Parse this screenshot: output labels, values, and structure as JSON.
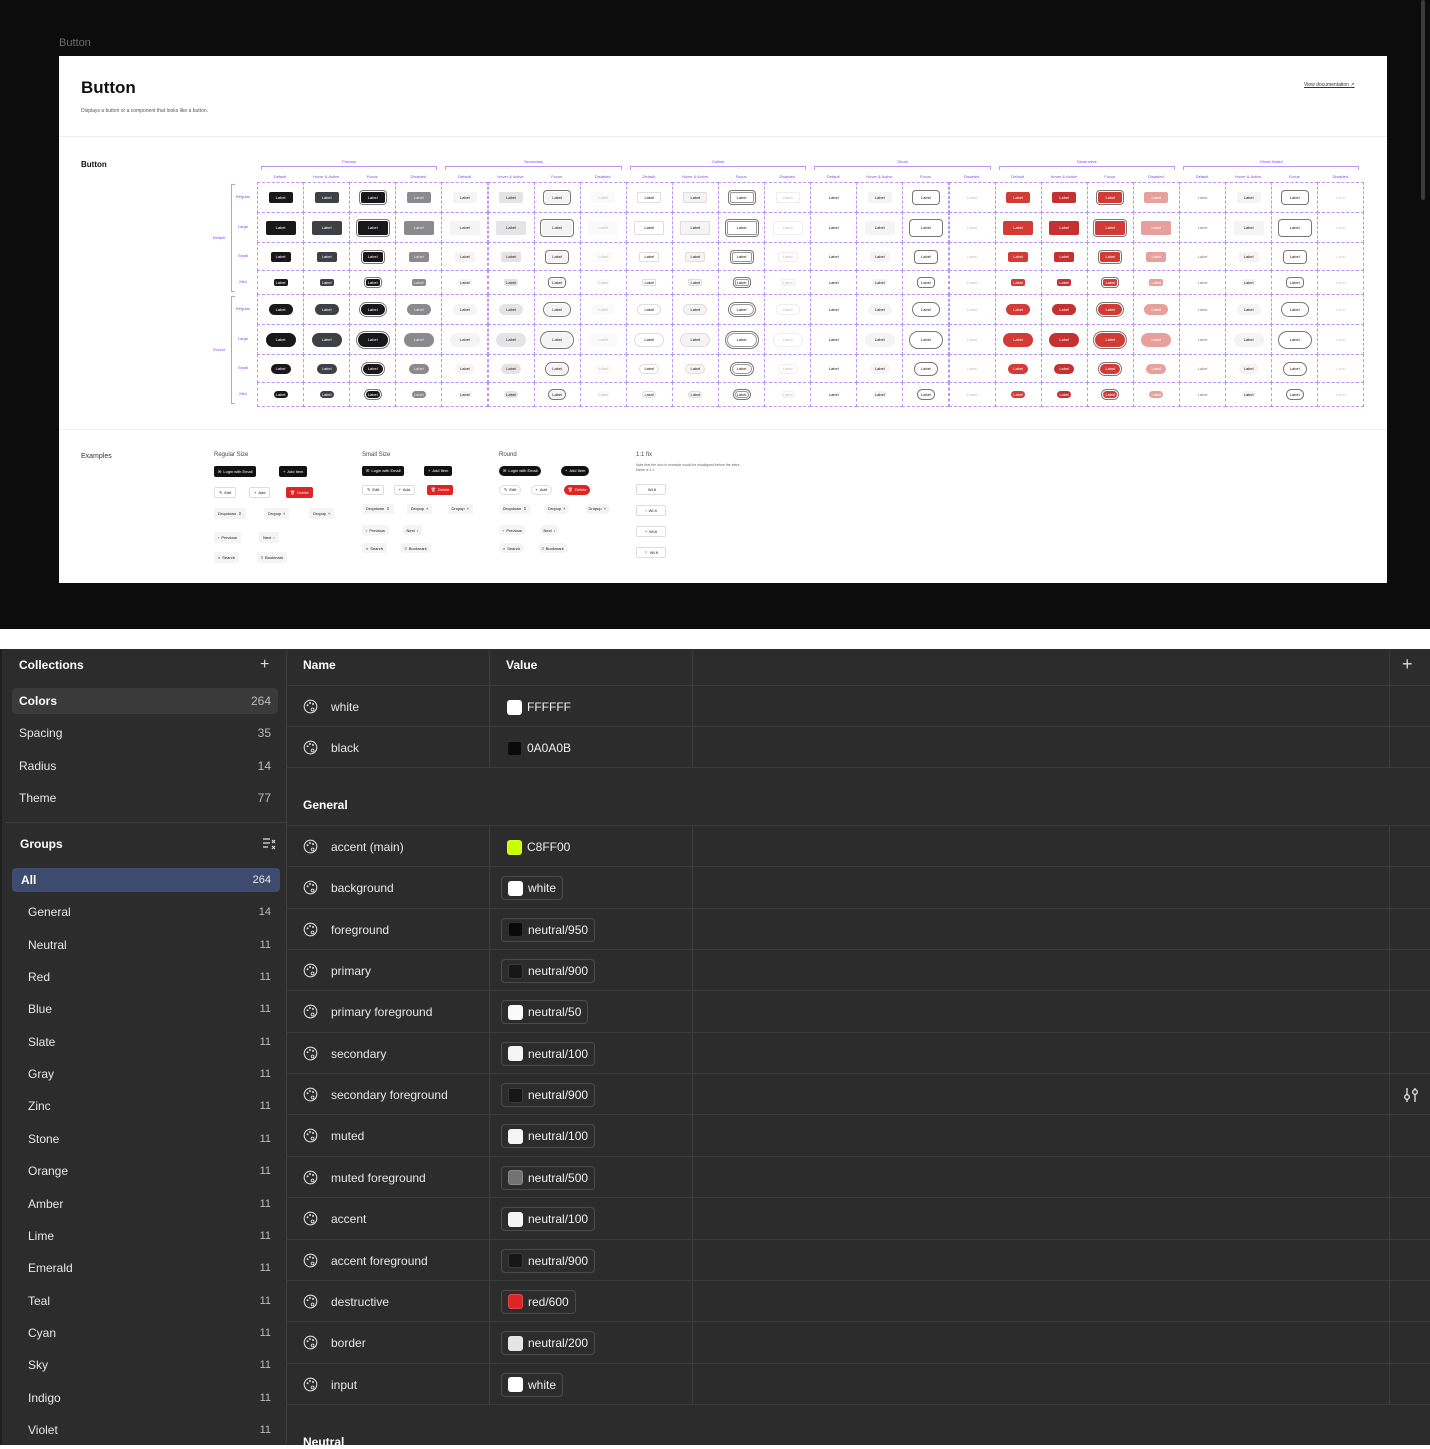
{
  "frame_label": "Button",
  "doc": {
    "title": "Button",
    "description": "Displays a button or a component that looks like a button.",
    "link": "View documentation",
    "section_button": "Button",
    "section_examples": "Examples"
  },
  "matrix": {
    "variants": [
      "Primary",
      "Secondary",
      "Outline",
      "Ghost",
      "Destructive",
      "Ghost Muted"
    ],
    "states": [
      "Default",
      "Hover & Active",
      "Focus",
      "Disabled"
    ],
    "shapes": [
      "Default",
      "Round"
    ],
    "sizes": [
      "Regular",
      "Large",
      "Small",
      "Mini"
    ],
    "button_label": "Label"
  },
  "examples": {
    "groups": [
      {
        "title": "Regular Size"
      },
      {
        "title": "Small Size"
      },
      {
        "title": "Round"
      }
    ],
    "login": "Login with Email",
    "add_item": "Add Item",
    "edit": "Edit",
    "add": "Add",
    "delete": "Delete",
    "dropdown": "Dropdown",
    "dropup": "Dropup",
    "dropup2": "Dropup",
    "previous": "Previous",
    "next": "Next",
    "search": "Search",
    "bookmark": "Bookmark",
    "fix_title": "1:1 fix",
    "fix_note": "Note that the icon in example would be misaligned before the extra frame is 1:1",
    "wifi": "Wi-fi"
  },
  "panel": {
    "collections_title": "Collections",
    "collections": [
      {
        "name": "Colors",
        "count": "264"
      },
      {
        "name": "Spacing",
        "count": "35"
      },
      {
        "name": "Radius",
        "count": "14"
      },
      {
        "name": "Theme",
        "count": "77"
      }
    ],
    "groups_title": "Groups",
    "groups": [
      {
        "name": "All",
        "count": "264"
      },
      {
        "name": "General",
        "count": "14"
      },
      {
        "name": "Neutral",
        "count": "11"
      },
      {
        "name": "Red",
        "count": "11"
      },
      {
        "name": "Blue",
        "count": "11"
      },
      {
        "name": "Slate",
        "count": "11"
      },
      {
        "name": "Gray",
        "count": "11"
      },
      {
        "name": "Zinc",
        "count": "11"
      },
      {
        "name": "Stone",
        "count": "11"
      },
      {
        "name": "Orange",
        "count": "11"
      },
      {
        "name": "Amber",
        "count": "11"
      },
      {
        "name": "Lime",
        "count": "11"
      },
      {
        "name": "Emerald",
        "count": "11"
      },
      {
        "name": "Teal",
        "count": "11"
      },
      {
        "name": "Cyan",
        "count": "11"
      },
      {
        "name": "Sky",
        "count": "11"
      },
      {
        "name": "Indigo",
        "count": "11"
      },
      {
        "name": "Violet",
        "count": "11"
      }
    ],
    "columns": {
      "name": "Name",
      "value": "Value"
    },
    "ungrouped": [
      {
        "name": "white",
        "value": "FFFFFF",
        "swatch": "#ffffff",
        "alias": false
      },
      {
        "name": "black",
        "value": "0A0A0B",
        "swatch": "#0a0a0b",
        "alias": false
      }
    ],
    "general_title": "General",
    "general": [
      {
        "name": "accent (main)",
        "value": "C8FF00",
        "swatch": "#c8ff00",
        "alias": false
      },
      {
        "name": "background",
        "value": "white",
        "swatch": "#ffffff",
        "alias": true
      },
      {
        "name": "foreground",
        "value": "neutral/950",
        "swatch": "#0a0a0a",
        "alias": true
      },
      {
        "name": "primary",
        "value": "neutral/900",
        "swatch": "#171717",
        "alias": true
      },
      {
        "name": "primary foreground",
        "value": "neutral/50",
        "swatch": "#fafafa",
        "alias": true
      },
      {
        "name": "secondary",
        "value": "neutral/100",
        "swatch": "#f5f5f5",
        "alias": true
      },
      {
        "name": "secondary foreground",
        "value": "neutral/900",
        "swatch": "#171717",
        "alias": true
      },
      {
        "name": "muted",
        "value": "neutral/100",
        "swatch": "#f5f5f5",
        "alias": true
      },
      {
        "name": "muted foreground",
        "value": "neutral/500",
        "swatch": "#737373",
        "alias": true
      },
      {
        "name": "accent",
        "value": "neutral/100",
        "swatch": "#f5f5f5",
        "alias": true
      },
      {
        "name": "accent foreground",
        "value": "neutral/900",
        "swatch": "#171717",
        "alias": true
      },
      {
        "name": "destructive",
        "value": "red/600",
        "swatch": "#dc2626",
        "alias": true
      },
      {
        "name": "border",
        "value": "neutral/200",
        "swatch": "#e5e5e5",
        "alias": true
      },
      {
        "name": "input",
        "value": "white",
        "swatch": "#ffffff",
        "alias": true
      }
    ],
    "neutral_title": "Neutral"
  },
  "colors": {
    "primary": "#171717",
    "destructive": "#d23b36",
    "guide": "#8a3ffc"
  }
}
